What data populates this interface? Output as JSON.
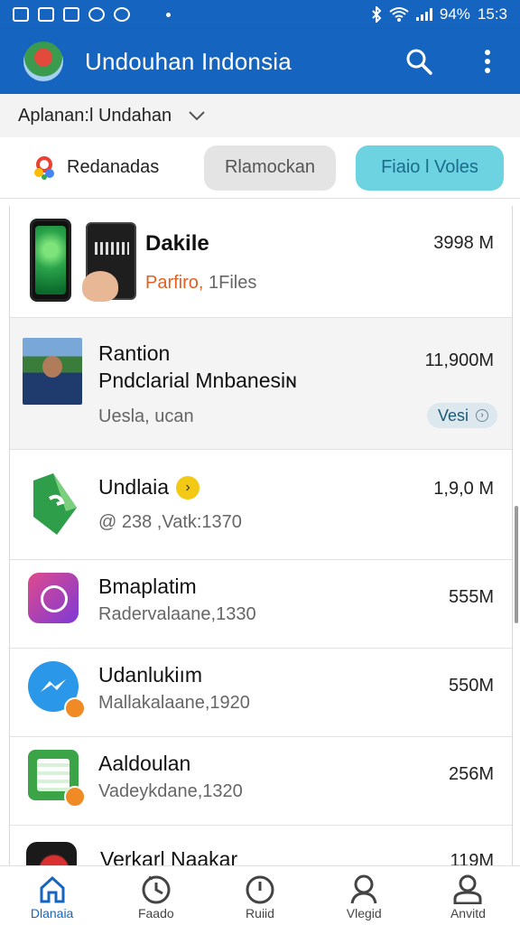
{
  "status_bar": {
    "battery": "94%",
    "time": "15:3"
  },
  "app_bar": {
    "title": "Undouhan Indonsia",
    "search_icon": "search-icon",
    "menu_icon": "more-vertical-icon"
  },
  "filter": {
    "label": "Aplanan:l Undahan"
  },
  "chips": {
    "source_label": "Redanadas",
    "chip1": "Rlamockan",
    "chip2": "Fiaio l Voles"
  },
  "list": {
    "items": [
      {
        "title": "Dakile",
        "sub_highlight": "Parfiro,",
        "sub_rest": " 1Files",
        "size": "3998 M"
      },
      {
        "title": "Rantion",
        "title2": "Pndclarial Mnbanesiɴ",
        "sub": "Uesla, ucan",
        "size": "11,900M",
        "badge": "Vesi"
      },
      {
        "title": "Undlaia",
        "sub": "@ 238 ,Vatk:1370",
        "size": "1,9,0 M"
      },
      {
        "title": "Bmaplatim",
        "sub": "Radervalaane,1330",
        "size": "555M"
      },
      {
        "title": "Udanlukiım",
        "sub": "Mallakalaane,1920",
        "size": "550M"
      },
      {
        "title": "Aaldoulan",
        "sub": "Vadeykdane,1320",
        "size": "256M"
      },
      {
        "title": "Verkarl Naakar",
        "size": "119M"
      }
    ]
  },
  "bottom_nav": {
    "items": [
      {
        "label": "Dlanaia"
      },
      {
        "label": "Faado"
      },
      {
        "label": "Ruiid"
      },
      {
        "label": "Vlegid"
      },
      {
        "label": "Anvitd"
      }
    ]
  },
  "colors": {
    "primary": "#1565c0",
    "accent_cyan": "#6dd3e0",
    "highlight_orange": "#e2601f"
  }
}
